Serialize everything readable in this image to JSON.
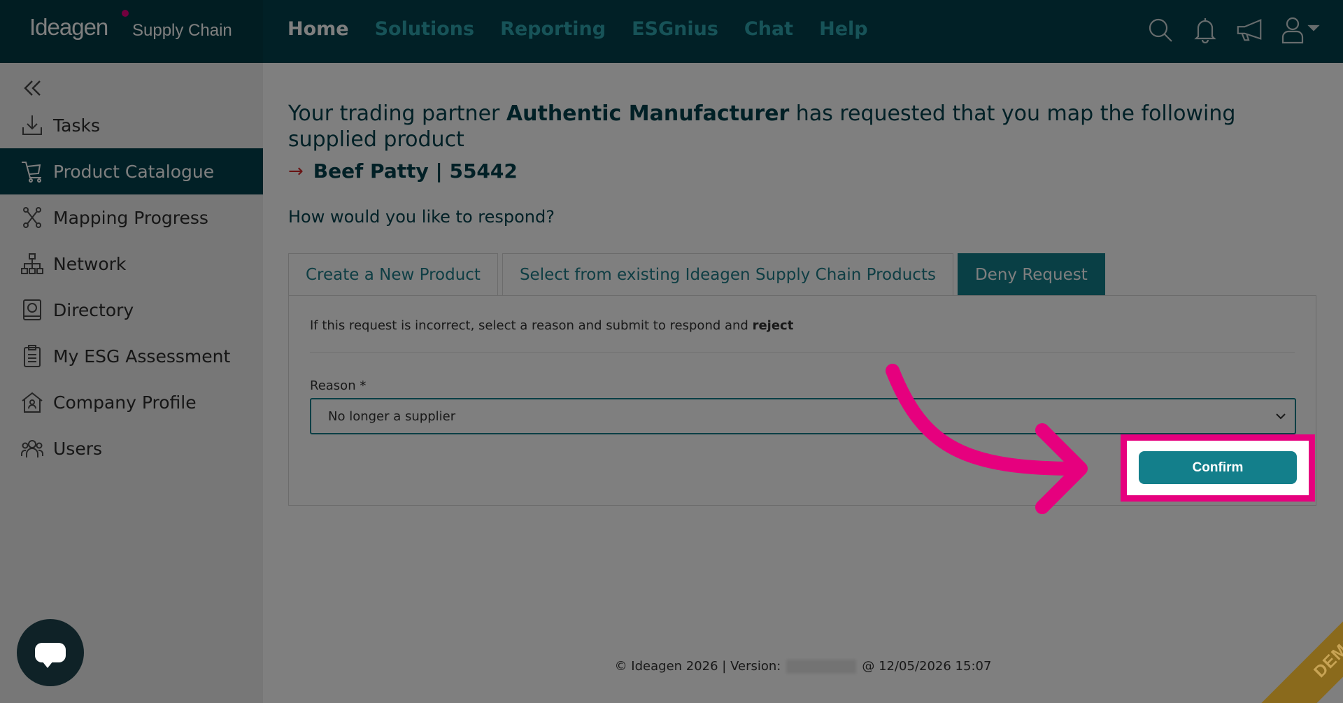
{
  "brand": {
    "logo_main": "Ideagen",
    "logo_sub": "Supply Chain"
  },
  "topnav": {
    "items": [
      {
        "label": "Home",
        "active": true
      },
      {
        "label": "Solutions"
      },
      {
        "label": "Reporting"
      },
      {
        "label": "ESGnius"
      },
      {
        "label": "Chat"
      },
      {
        "label": "Help"
      }
    ]
  },
  "top_icons": [
    "search-icon",
    "bell-icon",
    "megaphone-icon",
    "user-icon"
  ],
  "sidebar": {
    "items": [
      {
        "label": "Tasks",
        "icon": "download-tray-icon"
      },
      {
        "label": "Product Catalogue",
        "icon": "cart-icon",
        "active": true
      },
      {
        "label": "Mapping Progress",
        "icon": "mapping-icon"
      },
      {
        "label": "Network",
        "icon": "network-icon"
      },
      {
        "label": "Directory",
        "icon": "directory-icon"
      },
      {
        "label": "My ESG Assessment",
        "icon": "clipboard-icon"
      },
      {
        "label": "Company Profile",
        "icon": "company-icon"
      },
      {
        "label": "Users",
        "icon": "users-icon"
      }
    ]
  },
  "main": {
    "heading_pre": "Your trading partner ",
    "partner_name": "Authentic Manufacturer",
    "heading_post": " has requested that you map the following supplied product",
    "product": "Beef Patty | 55442",
    "question": "How would you like to respond?",
    "tabs": [
      {
        "label": "Create a New Product"
      },
      {
        "label": "Select from existing Ideagen Supply Chain Products"
      },
      {
        "label": "Deny Request",
        "active": true
      }
    ],
    "panel_text_pre": "If this request is incorrect, select a reason and submit to respond and ",
    "panel_text_bold": "reject",
    "reason_label": "Reason *",
    "reason_value": "No longer a supplier",
    "confirm_label": "Confirm"
  },
  "footer": {
    "left": "© Ideagen 2026 | Version:",
    "right": "@ 12/05/2026 15:07"
  },
  "demo_label": "DEMO",
  "colors": {
    "header": "#02414c",
    "accent": "#137f8b",
    "highlight": "#e6007e",
    "nav_inactive": "#2ea7b0"
  }
}
